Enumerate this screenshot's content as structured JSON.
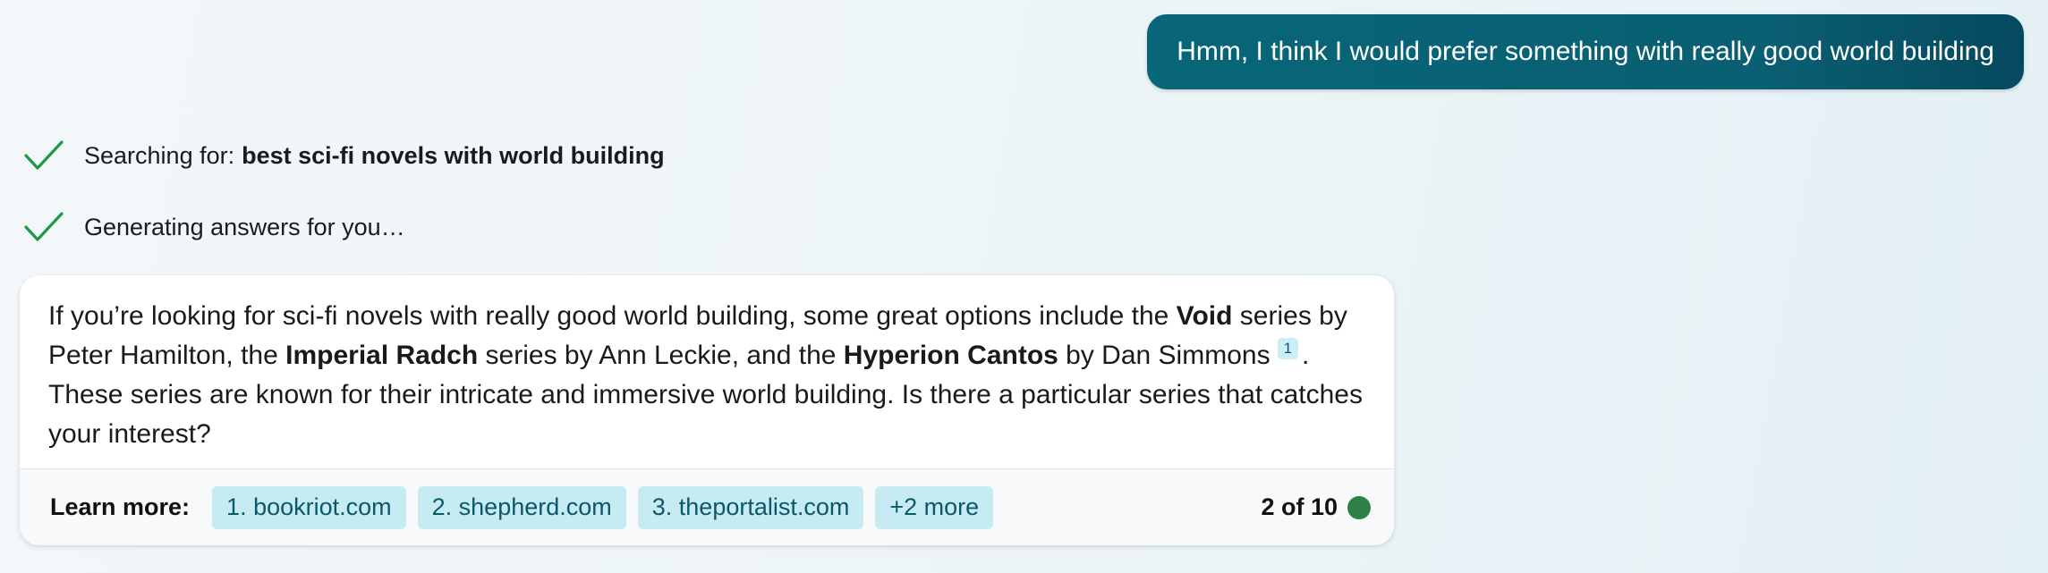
{
  "user_message": {
    "text": "Hmm, I think I would prefer something with really good world building"
  },
  "status": [
    {
      "icon": "check-icon",
      "prefix": "Searching for:",
      "query": "best sci-fi novels with world building"
    },
    {
      "icon": "check-icon",
      "prefix": "Generating answers for you…"
    }
  ],
  "answer": {
    "t1": "If you’re looking for sci-fi novels with really good world building, some great options include the ",
    "b1": "Void",
    "t2": " series by Peter Hamilton, the ",
    "b2": "Imperial Radch",
    "t3": " series by Ann Leckie, and the ",
    "b3": "Hyperion Cantos",
    "t4": " by Dan Simmons",
    "citation": "1",
    "t5": ". These series are known for their intricate and immersive world building. Is there a particular series that catches your interest?"
  },
  "footer": {
    "learn_more_label": "Learn more:",
    "links": [
      "1. bookriot.com",
      "2. shepherd.com",
      "3. theportalist.com",
      "+2 more"
    ],
    "counter": "2 of 10"
  },
  "colors": {
    "user_bubble": "#0a5f72",
    "check": "#1e9a3c",
    "chip_bg": "#c6ebf3",
    "chip_text": "#0b5868",
    "status_dot": "#2f7f47"
  }
}
